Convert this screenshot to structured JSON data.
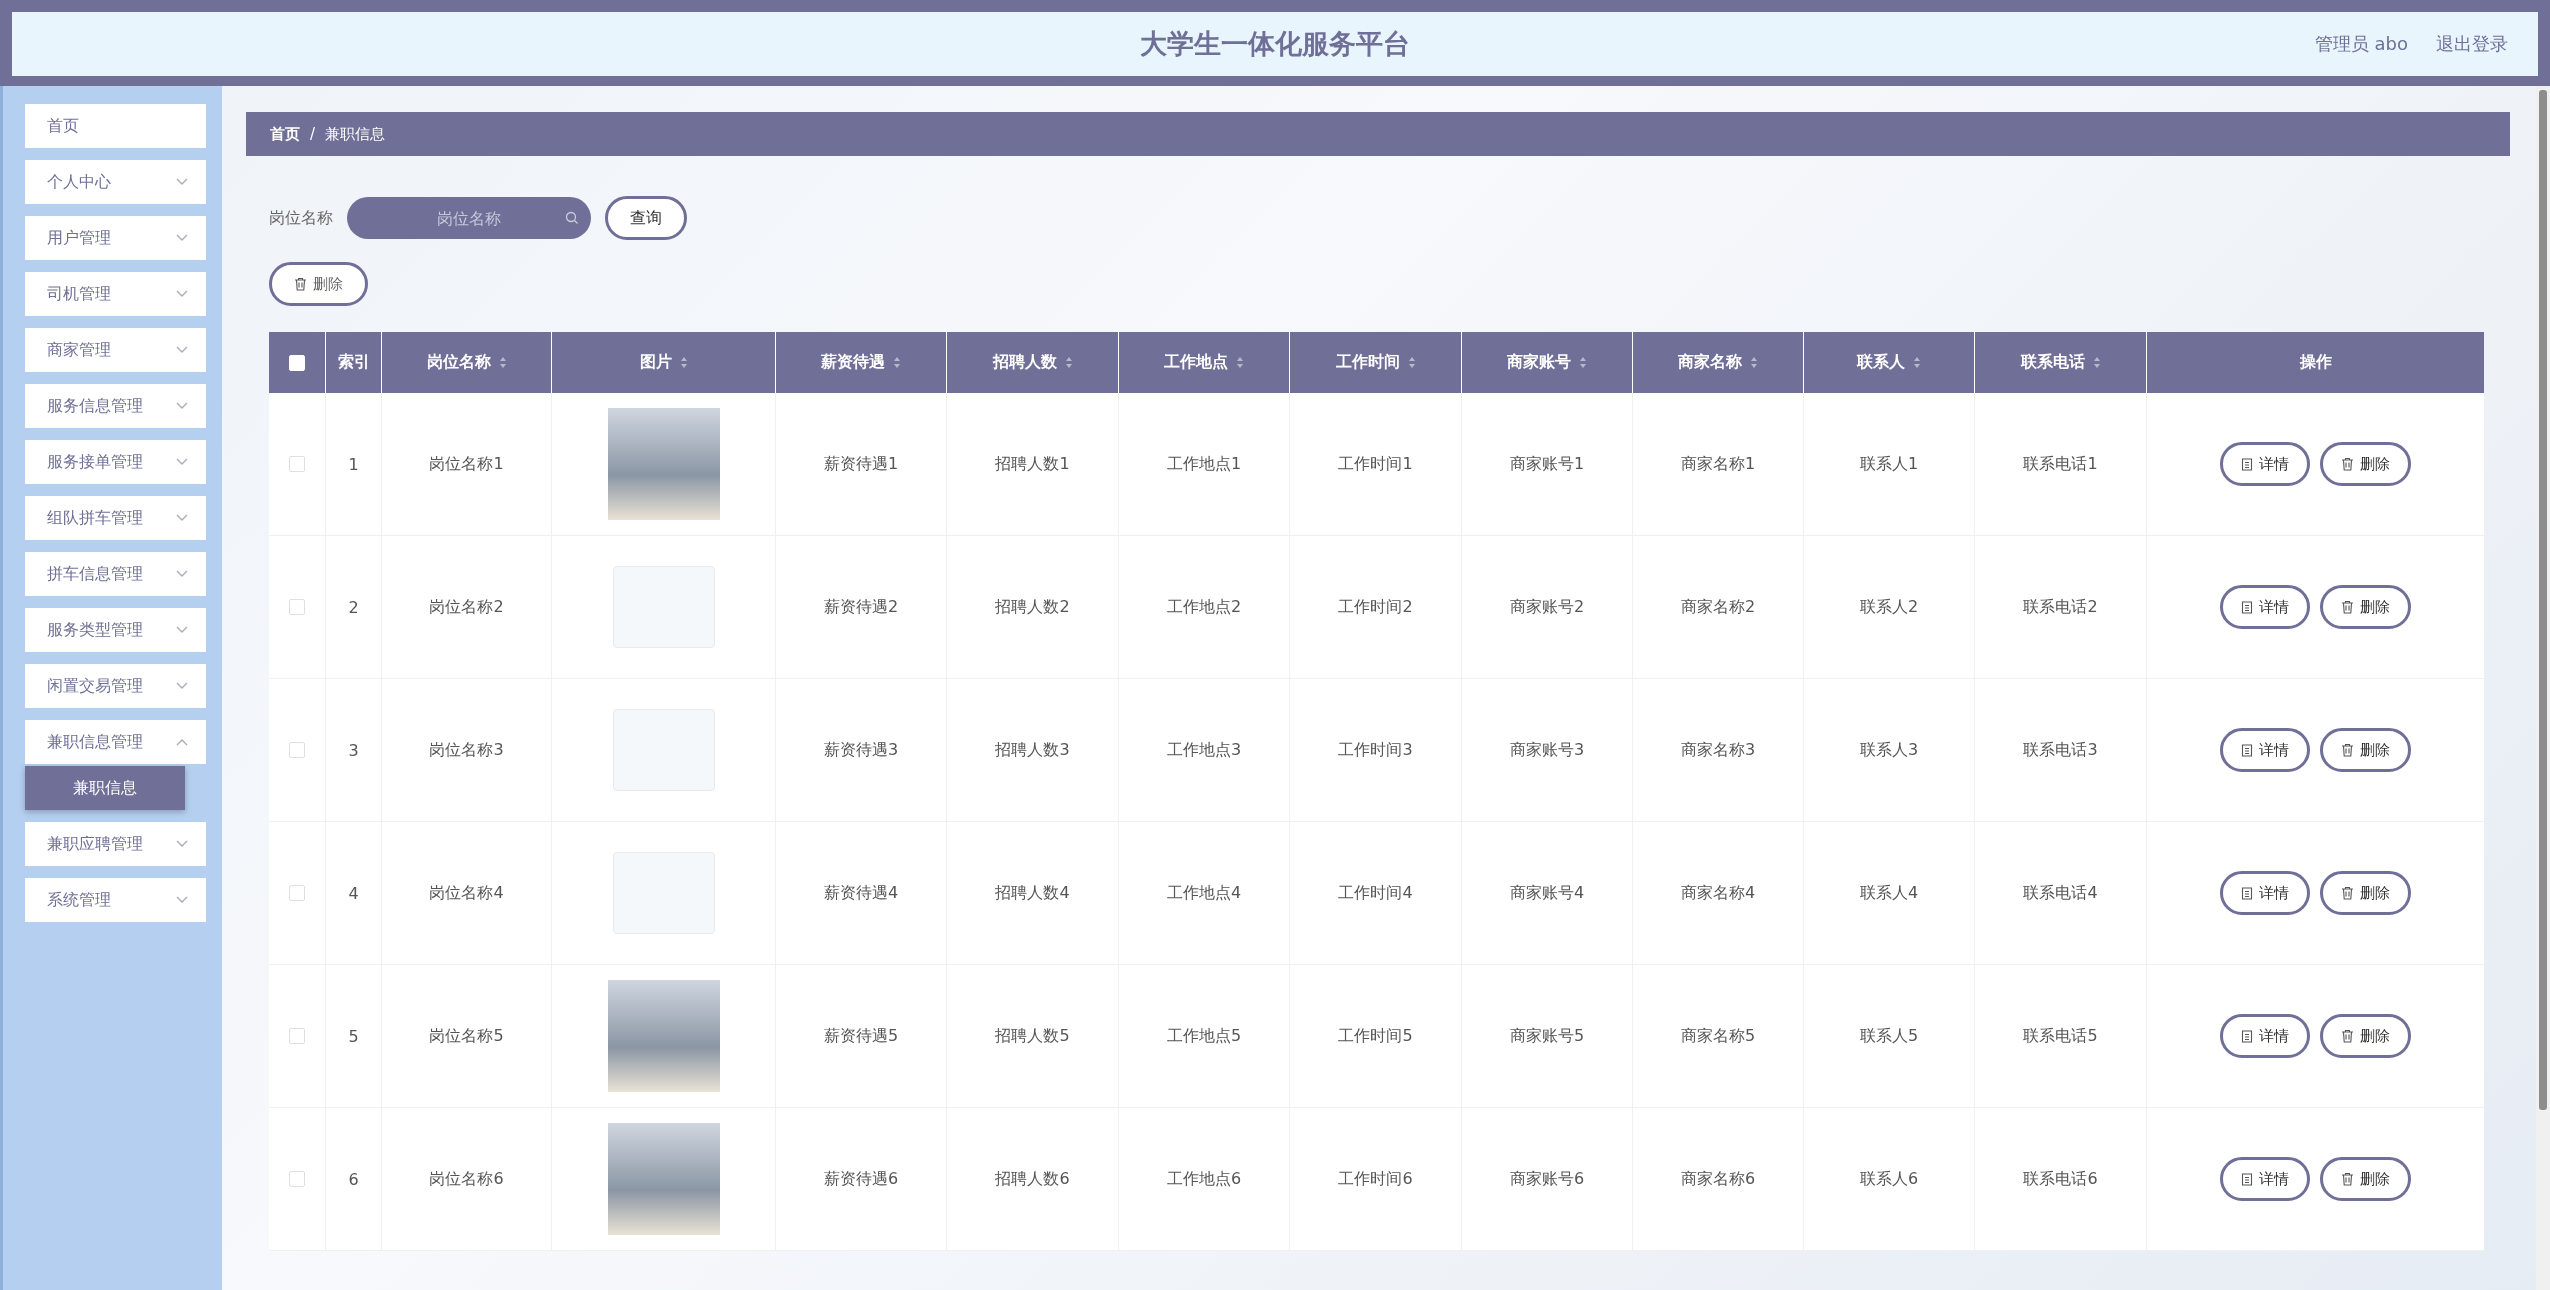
{
  "header": {
    "title": "大学生一体化服务平台",
    "user": "管理员 abo",
    "logout": "退出登录"
  },
  "sidebar": {
    "items": [
      {
        "label": "首页",
        "kind": "link"
      },
      {
        "label": "个人中心",
        "kind": "menu",
        "expanded": false
      },
      {
        "label": "用户管理",
        "kind": "menu",
        "expanded": false
      },
      {
        "label": "司机管理",
        "kind": "menu",
        "expanded": false
      },
      {
        "label": "商家管理",
        "kind": "menu",
        "expanded": false
      },
      {
        "label": "服务信息管理",
        "kind": "menu",
        "expanded": false
      },
      {
        "label": "服务接单管理",
        "kind": "menu",
        "expanded": false
      },
      {
        "label": "组队拼车管理",
        "kind": "menu",
        "expanded": false
      },
      {
        "label": "拼车信息管理",
        "kind": "menu",
        "expanded": false
      },
      {
        "label": "服务类型管理",
        "kind": "menu",
        "expanded": false
      },
      {
        "label": "闲置交易管理",
        "kind": "menu",
        "expanded": false
      },
      {
        "label": "兼职信息管理",
        "kind": "menu",
        "expanded": true,
        "children": [
          {
            "label": "兼职信息",
            "selected": true
          }
        ]
      },
      {
        "label": "兼职应聘管理",
        "kind": "menu",
        "expanded": false
      },
      {
        "label": "系统管理",
        "kind": "menu",
        "expanded": false
      }
    ]
  },
  "breadcrumb": [
    "首页",
    "/",
    "兼职信息"
  ],
  "search": {
    "label": "岗位名称",
    "placeholder": "岗位名称",
    "button": "查询"
  },
  "delete_button": "删除",
  "table": {
    "select_all": {
      "checked": false
    },
    "columns": [
      {
        "label": "索引",
        "sortable": false
      },
      {
        "label": "岗位名称",
        "sortable": true
      },
      {
        "label": "图片",
        "sortable": true
      },
      {
        "label": "薪资待遇",
        "sortable": true
      },
      {
        "label": "招聘人数",
        "sortable": true
      },
      {
        "label": "工作地点",
        "sortable": true
      },
      {
        "label": "工作时间",
        "sortable": true
      },
      {
        "label": "商家账号",
        "sortable": true
      },
      {
        "label": "商家名称",
        "sortable": true
      },
      {
        "label": "联系人",
        "sortable": true
      },
      {
        "label": "联系电话",
        "sortable": true
      },
      {
        "label": "操作",
        "sortable": false
      }
    ],
    "rows": [
      {
        "checked": false,
        "kind": "photo",
        "index": "1",
        "job_name": "岗位名称1",
        "salary": "薪资待遇1",
        "headcount": "招聘人数1",
        "location": "工作地点1",
        "work_time": "工作时间1",
        "merchant_account": "商家账号1",
        "merchant_name": "商家名称1",
        "contact": "联系人1",
        "phone": "联系电话1",
        "actions": [
          "详情",
          "删除"
        ]
      },
      {
        "checked": false,
        "kind": "logo",
        "index": "2",
        "job_name": "岗位名称2",
        "salary": "薪资待遇2",
        "headcount": "招聘人数2",
        "location": "工作地点2",
        "work_time": "工作时间2",
        "merchant_account": "商家账号2",
        "merchant_name": "商家名称2",
        "contact": "联系人2",
        "phone": "联系电话2",
        "actions": [
          "详情",
          "删除"
        ]
      },
      {
        "checked": false,
        "kind": "logo",
        "index": "3",
        "job_name": "岗位名称3",
        "salary": "薪资待遇3",
        "headcount": "招聘人数3",
        "location": "工作地点3",
        "work_time": "工作时间3",
        "merchant_account": "商家账号3",
        "merchant_name": "商家名称3",
        "contact": "联系人3",
        "phone": "联系电话3",
        "actions": [
          "详情",
          "删除"
        ]
      },
      {
        "checked": false,
        "kind": "logo",
        "index": "4",
        "job_name": "岗位名称4",
        "salary": "薪资待遇4",
        "headcount": "招聘人数4",
        "location": "工作地点4",
        "work_time": "工作时间4",
        "merchant_account": "商家账号4",
        "merchant_name": "商家名称4",
        "contact": "联系人4",
        "phone": "联系电话4",
        "actions": [
          "详情",
          "删除"
        ]
      },
      {
        "checked": false,
        "kind": "photo",
        "index": "5",
        "job_name": "岗位名称5",
        "salary": "薪资待遇5",
        "headcount": "招聘人数5",
        "location": "工作地点5",
        "work_time": "工作时间5",
        "merchant_account": "商家账号5",
        "merchant_name": "商家名称5",
        "contact": "联系人5",
        "phone": "联系电话5",
        "actions": [
          "详情",
          "删除"
        ]
      },
      {
        "checked": false,
        "kind": "photo",
        "index": "6",
        "job_name": "岗位名称6",
        "salary": "薪资待遇6",
        "headcount": "招聘人数6",
        "location": "工作地点6",
        "work_time": "工作时间6",
        "merchant_account": "商家账号6",
        "merchant_name": "商家名称6",
        "contact": "联系人6",
        "phone": "联系电话6",
        "actions": [
          "详情",
          "删除"
        ]
      }
    ]
  }
}
